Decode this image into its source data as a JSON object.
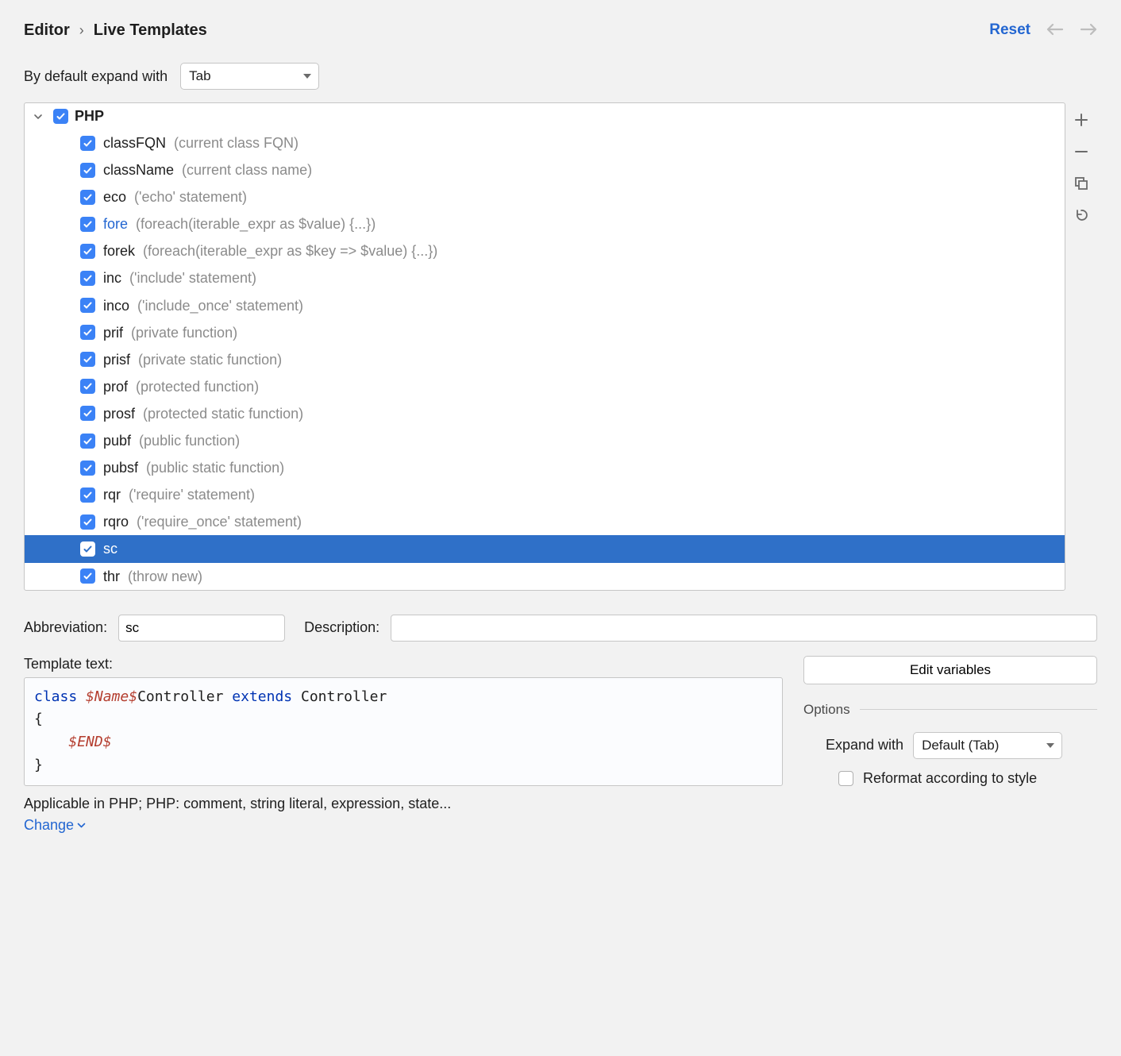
{
  "breadcrumb": {
    "parent": "Editor",
    "current": "Live Templates"
  },
  "header": {
    "reset": "Reset"
  },
  "defaultExpand": {
    "label": "By default expand with",
    "value": "Tab"
  },
  "group": {
    "name": "PHP"
  },
  "templates": [
    {
      "abbr": "classFQN",
      "desc": "(current class FQN)",
      "link": false,
      "selected": false
    },
    {
      "abbr": "className",
      "desc": "(current class name)",
      "link": false,
      "selected": false
    },
    {
      "abbr": "eco",
      "desc": "('echo' statement)",
      "link": false,
      "selected": false
    },
    {
      "abbr": "fore",
      "desc": "(foreach(iterable_expr as $value) {...})",
      "link": true,
      "selected": false
    },
    {
      "abbr": "forek",
      "desc": "(foreach(iterable_expr as $key => $value) {...})",
      "link": false,
      "selected": false
    },
    {
      "abbr": "inc",
      "desc": "('include' statement)",
      "link": false,
      "selected": false
    },
    {
      "abbr": "inco",
      "desc": "('include_once' statement)",
      "link": false,
      "selected": false
    },
    {
      "abbr": "prif",
      "desc": "(private function)",
      "link": false,
      "selected": false
    },
    {
      "abbr": "prisf",
      "desc": "(private static function)",
      "link": false,
      "selected": false
    },
    {
      "abbr": "prof",
      "desc": "(protected function)",
      "link": false,
      "selected": false
    },
    {
      "abbr": "prosf",
      "desc": "(protected static function)",
      "link": false,
      "selected": false
    },
    {
      "abbr": "pubf",
      "desc": "(public function)",
      "link": false,
      "selected": false
    },
    {
      "abbr": "pubsf",
      "desc": "(public static function)",
      "link": false,
      "selected": false
    },
    {
      "abbr": "rqr",
      "desc": "('require' statement)",
      "link": false,
      "selected": false
    },
    {
      "abbr": "rqro",
      "desc": "('require_once' statement)",
      "link": false,
      "selected": false
    },
    {
      "abbr": "sc",
      "desc": "",
      "link": false,
      "selected": true
    },
    {
      "abbr": "thr",
      "desc": "(throw new)",
      "link": false,
      "selected": false
    }
  ],
  "detail": {
    "abbrevLabel": "Abbreviation:",
    "abbrevValue": "sc",
    "descLabel": "Description:",
    "descValue": "",
    "templateTextLabel": "Template text:",
    "code": {
      "kw1": "class",
      "var1": "$Name$",
      "ident1": "Controller",
      "kw2": "extends",
      "ident2": "Controller",
      "open": "{",
      "indent": "    ",
      "var2": "$END$",
      "close": "}"
    },
    "applicable": "Applicable in PHP; PHP: comment, string literal, expression, state...",
    "change": "Change",
    "editVariables": "Edit variables",
    "optionsHeader": "Options",
    "expandWithLabel": "Expand with",
    "expandWithValue": "Default (Tab)",
    "reformat": "Reformat according to style"
  }
}
